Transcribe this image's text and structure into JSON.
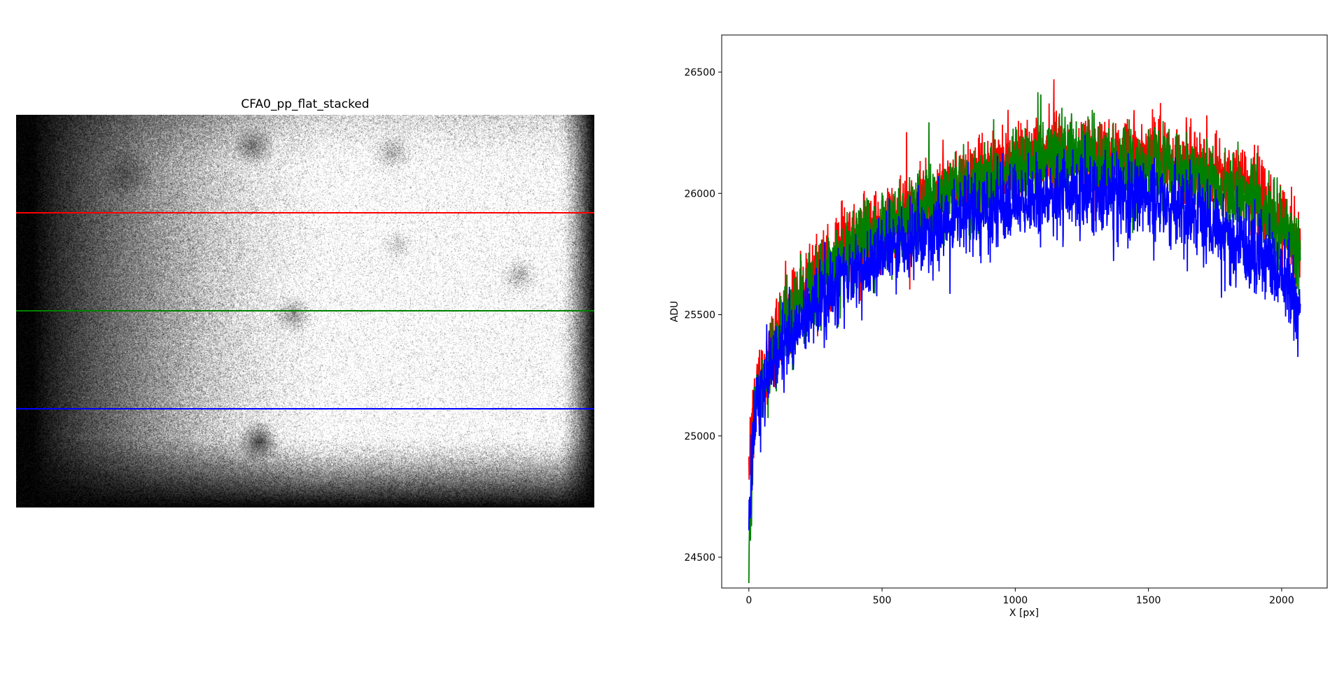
{
  "image_panel": {
    "title": "CFA0_pp_flat_stacked",
    "row_markers": [
      {
        "color": "#ff0000",
        "row_fraction": 0.25
      },
      {
        "color": "#008000",
        "row_fraction": 0.5
      },
      {
        "color": "#0000ff",
        "row_fraction": 0.75
      }
    ]
  },
  "chart_data": {
    "type": "line",
    "title": "",
    "xlabel": "X [px]",
    "ylabel": "ADU",
    "xlim": [
      -102,
      2171
    ],
    "ylim": [
      24373,
      26653
    ],
    "xticks": [
      0,
      500,
      1000,
      1500,
      2000
    ],
    "yticks": [
      24500,
      25000,
      25500,
      26000,
      26500
    ],
    "grid": false,
    "trend_x": [
      0,
      20,
      100,
      200,
      300,
      500,
      800,
      1000,
      1200,
      1500,
      1700,
      1900,
      2000,
      2070
    ],
    "noise_adu": 150,
    "series": [
      {
        "name": "red row",
        "color": "#ff0000",
        "trend": [
          24900,
          25150,
          25400,
          25600,
          25720,
          25870,
          26050,
          26130,
          26170,
          26150,
          26100,
          26000,
          25900,
          25750
        ]
      },
      {
        "name": "green row",
        "color": "#008000",
        "trend": [
          24500,
          25100,
          25380,
          25570,
          25680,
          25840,
          26020,
          26110,
          26150,
          26120,
          26060,
          25960,
          25850,
          25780
        ]
      },
      {
        "name": "blue row",
        "color": "#0000ff",
        "trend": [
          24700,
          25100,
          25300,
          25480,
          25600,
          25760,
          25900,
          25970,
          26000,
          25980,
          25900,
          25760,
          25640,
          25550
        ]
      }
    ]
  }
}
